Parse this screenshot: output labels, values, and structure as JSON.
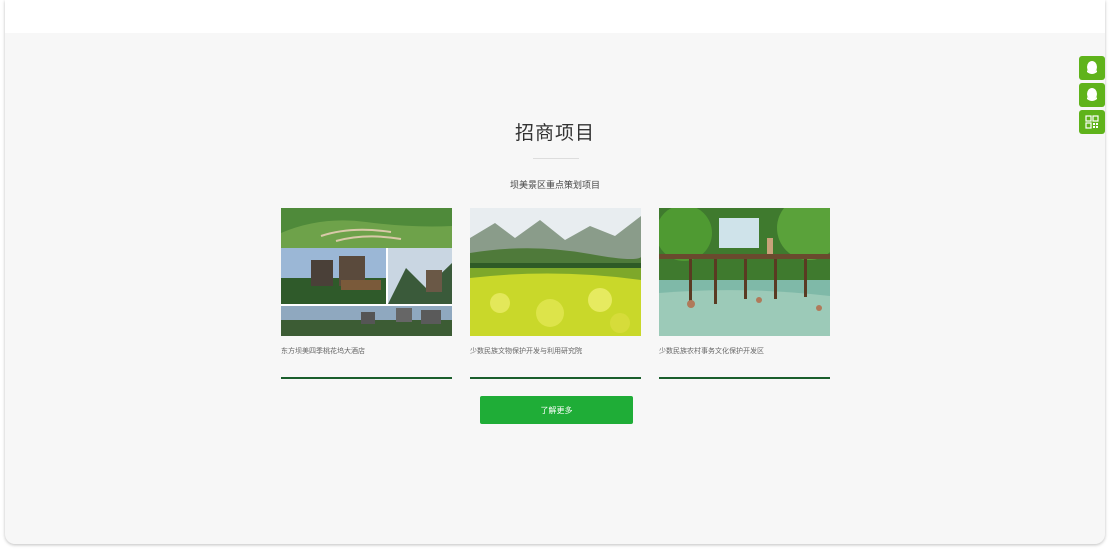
{
  "section": {
    "title": "招商项目",
    "subtitle": "坝美景区重点策划项目"
  },
  "projects": [
    {
      "caption": "东方坝美四季桃花坞大酒店",
      "image": "hillside-villas-photo"
    },
    {
      "caption": "少数民族文物保护开发与利用研究院",
      "image": "rapeseed-field-karst-photo"
    },
    {
      "caption": "少数民族农村事务文化保护开发区",
      "image": "river-wooden-bridge-photo"
    }
  ],
  "more_button": {
    "label": "了解更多"
  },
  "float_bar": {
    "items": [
      {
        "icon": "qq-icon"
      },
      {
        "icon": "qq-icon"
      },
      {
        "icon": "qr-code-icon"
      }
    ]
  },
  "colors": {
    "accent": "#1fad37",
    "float_bar": "#5fb31b",
    "underline": "#1a5e2c",
    "background": "#f7f7f7"
  }
}
